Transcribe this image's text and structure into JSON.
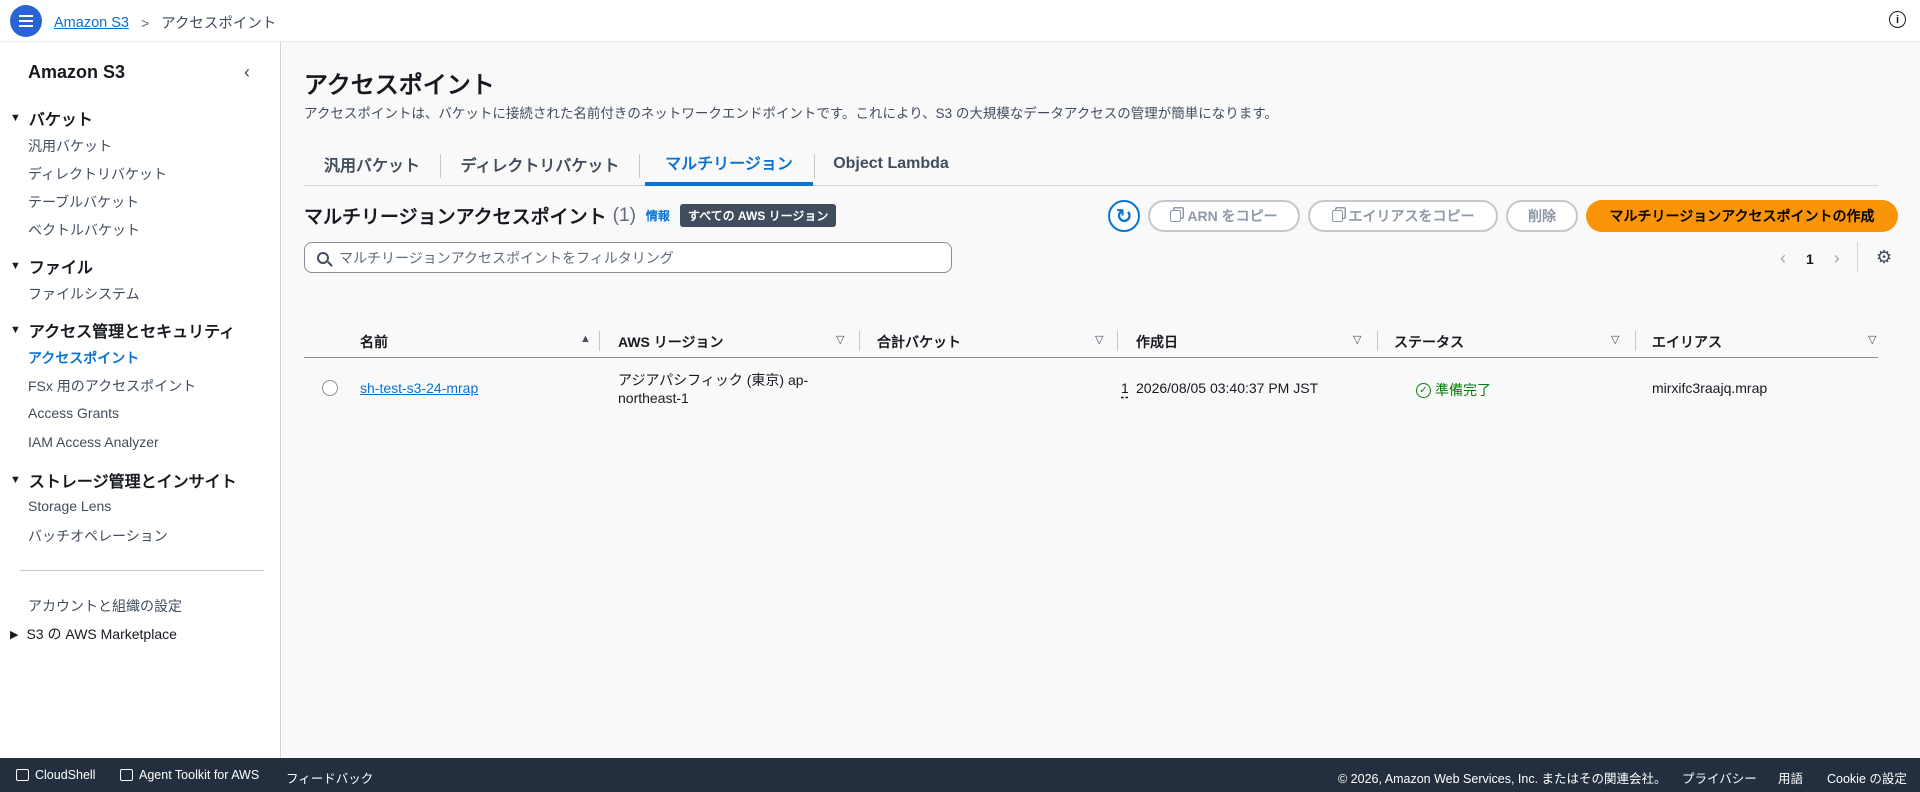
{
  "topbar": {
    "breadcrumb_root": "Amazon S3",
    "breadcrumb_separator": ">",
    "breadcrumb_current": "アクセスポイント"
  },
  "sidebar": {
    "title": "Amazon S3",
    "sections": [
      {
        "label": "バケット",
        "items": [
          "汎用バケット",
          "ディレクトリバケット",
          "テーブルバケット",
          "ベクトルバケット"
        ]
      },
      {
        "label": "ファイル",
        "items": [
          "ファイルシステム"
        ]
      },
      {
        "label": "アクセス管理とセキュリティ",
        "items": [
          "アクセスポイント",
          "FSx 用のアクセスポイント",
          "Access Grants",
          "IAM Access Analyzer"
        ]
      },
      {
        "label": "ストレージ管理とインサイト",
        "items": [
          "Storage Lens",
          "バッチオペレーション"
        ]
      }
    ],
    "active_item": "アクセスポイント",
    "footer_items": [
      "アカウントと組織の設定",
      "S3 の AWS Marketplace"
    ]
  },
  "main": {
    "title": "アクセスポイント",
    "description": "アクセスポイントは、バケットに接続された名前付きのネットワークエンドポイントです。これにより、S3 の大規模なデータアクセスの管理が簡単になります。",
    "tabs": [
      "汎用バケット",
      "ディレクトリバケット",
      "マルチリージョン",
      "Object Lambda"
    ],
    "active_tab": "マルチリージョン",
    "section_title": "マルチリージョンアクセスポイント",
    "section_count": "(1)",
    "info_link": "情報",
    "region_badge": "すべての AWS リージョン",
    "buttons": {
      "copy_arn": "ARN をコピー",
      "copy_alias": "エイリアスをコピー",
      "delete": "削除",
      "create": "マルチリージョンアクセスポイントの作成"
    },
    "search_placeholder": "マルチリージョンアクセスポイントをフィルタリング",
    "pagination_page": "1",
    "table": {
      "columns": [
        "名前",
        "AWS リージョン",
        "合計バケット",
        "作成日",
        "ステータス",
        "エイリアス"
      ],
      "rows": [
        {
          "name": "sh-test-s3-24-mrap",
          "region_line1": "アジアパシフィック (東京) ap-",
          "region_line2": "northeast-1",
          "buckets": "1",
          "created": "2026/08/05 03:40:37 PM JST",
          "status": "準備完了",
          "alias": "mirxifc3raajq.mrap"
        }
      ]
    }
  },
  "footer": {
    "cloudshell": "CloudShell",
    "agent_toolkit": "Agent Toolkit for AWS",
    "feedback": "フィードバック",
    "copyright": "© 2026, Amazon Web Services, Inc. またはその関連会社。",
    "privacy": "プライバシー",
    "terms": "用語",
    "cookie": "Cookie の設定"
  },
  "colors": {
    "accent": "#0972d3",
    "primary_button": "#f89406",
    "footer_bg": "#232f3e",
    "status_ok": "#037f0c"
  }
}
